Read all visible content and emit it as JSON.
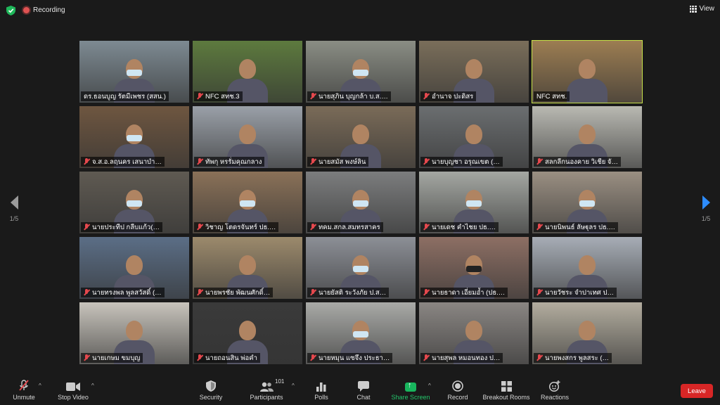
{
  "top_bar": {
    "recording_label": "Recording",
    "view_label": "View"
  },
  "pagination": {
    "left_label": "1/5",
    "right_label": "1/5"
  },
  "participants": [
    {
      "name": "ดร.ธอนบูญ รัตมีเพชร (สสน.)",
      "muted": false,
      "mask": "light",
      "bg": "#7d8a92"
    },
    {
      "name": "NFC สทช.3",
      "muted": true,
      "mask": "none",
      "bg": "#5d7a3e"
    },
    {
      "name": "นายสุภิน บุญกล้า บ.ส.…",
      "muted": true,
      "mask": "light",
      "bg": "#8a8d84"
    },
    {
      "name": "อำนาจ ปะดิสร",
      "muted": true,
      "mask": "none",
      "bg": "#7a6e5a"
    },
    {
      "name": "NFC สทช.",
      "muted": false,
      "mask": "none",
      "bg": "#9c7d52"
    },
    {
      "name": "จ.ส.อ.ลฤนคร เสนาบำ…",
      "muted": true,
      "mask": "light",
      "bg": "#6e5640"
    },
    {
      "name": "ทัพกุ หรรั่มคุณกลาง",
      "muted": true,
      "mask": "none",
      "bg": "#9aa0a8"
    },
    {
      "name": "นายสมัส พงษ์ลิน",
      "muted": true,
      "mask": "none",
      "bg": "#7a6b58"
    },
    {
      "name": "นายบุญชา อรุณเขต (…",
      "muted": true,
      "mask": "none",
      "bg": "#6b6e70"
    },
    {
      "name": "สลกลีกนองคาย วิเชีย จั…",
      "muted": true,
      "mask": "none",
      "bg": "#b9b9b2"
    },
    {
      "name": "นายประทีป กลีบแก้ว(…",
      "muted": true,
      "mask": "light",
      "bg": "#5f5a52"
    },
    {
      "name": "วิชาญ โตดรจันทร์ ปธ.…",
      "muted": true,
      "mask": "light",
      "bg": "#8a7158"
    },
    {
      "name": "ทคม.สกล.สมทรสาคร",
      "muted": true,
      "mask": "light",
      "bg": "#7c7d7e"
    },
    {
      "name": "นายเดช คำไชย ปธ.…",
      "muted": true,
      "mask": "light",
      "bg": "#a4a7a2"
    },
    {
      "name": "นายนิพนธ์ ลัษฐุลร ปธ.…",
      "muted": true,
      "mask": "light",
      "bg": "#9a8f82"
    },
    {
      "name": "นายทรงพล พูลสวัสดิ์ (…",
      "muted": true,
      "mask": "none",
      "bg": "#5b6e86"
    },
    {
      "name": "นายพรชัย พัฒนศักดิ์…",
      "muted": true,
      "mask": "none",
      "bg": "#9c8a6c"
    },
    {
      "name": "นายยัสติ ระวังภัย ป.ส…",
      "muted": true,
      "mask": "light",
      "bg": "#8c8f96"
    },
    {
      "name": "นายธาดา เอี่ยมอ้ำ (ปธ.…",
      "muted": true,
      "mask": "dark",
      "bg": "#8d6f64"
    },
    {
      "name": "นายวัชระ จำปาเทศ ป…",
      "muted": true,
      "mask": "none",
      "bg": "#a7adb6"
    },
    {
      "name": "นายเกษม ขมบุญ",
      "muted": true,
      "mask": "none",
      "bg": "#c8c4bc"
    },
    {
      "name": "นายถอนสิน พ่อคำ",
      "muted": true,
      "mask": "none",
      "bg": "#3a3a3a"
    },
    {
      "name": "นายหมุน แซจึง ประธา…",
      "muted": true,
      "mask": "light",
      "bg": "#a9aaa7"
    },
    {
      "name": "นายสุพล หมอนทอง ป…",
      "muted": true,
      "mask": "none",
      "bg": "#8a8683"
    },
    {
      "name": "นายพงสกร พูลสระ (…",
      "muted": true,
      "mask": "none",
      "bg": "#b3ad9f"
    }
  ],
  "toolbar": {
    "unmute": "Unmute",
    "stop_video": "Stop Video",
    "security": "Security",
    "participants": "Participants",
    "participants_count": "101",
    "polls": "Polls",
    "chat": "Chat",
    "share_screen": "Share Screen",
    "record": "Record",
    "breakout_rooms": "Breakout Rooms",
    "reactions": "Reactions",
    "leave": "Leave"
  },
  "colors": {
    "background": "#1a1a1a",
    "active_speaker_border": "#c8e34a",
    "leave_red": "#d72626",
    "share_green": "#18b55d",
    "accent_blue": "#2d8cff"
  }
}
